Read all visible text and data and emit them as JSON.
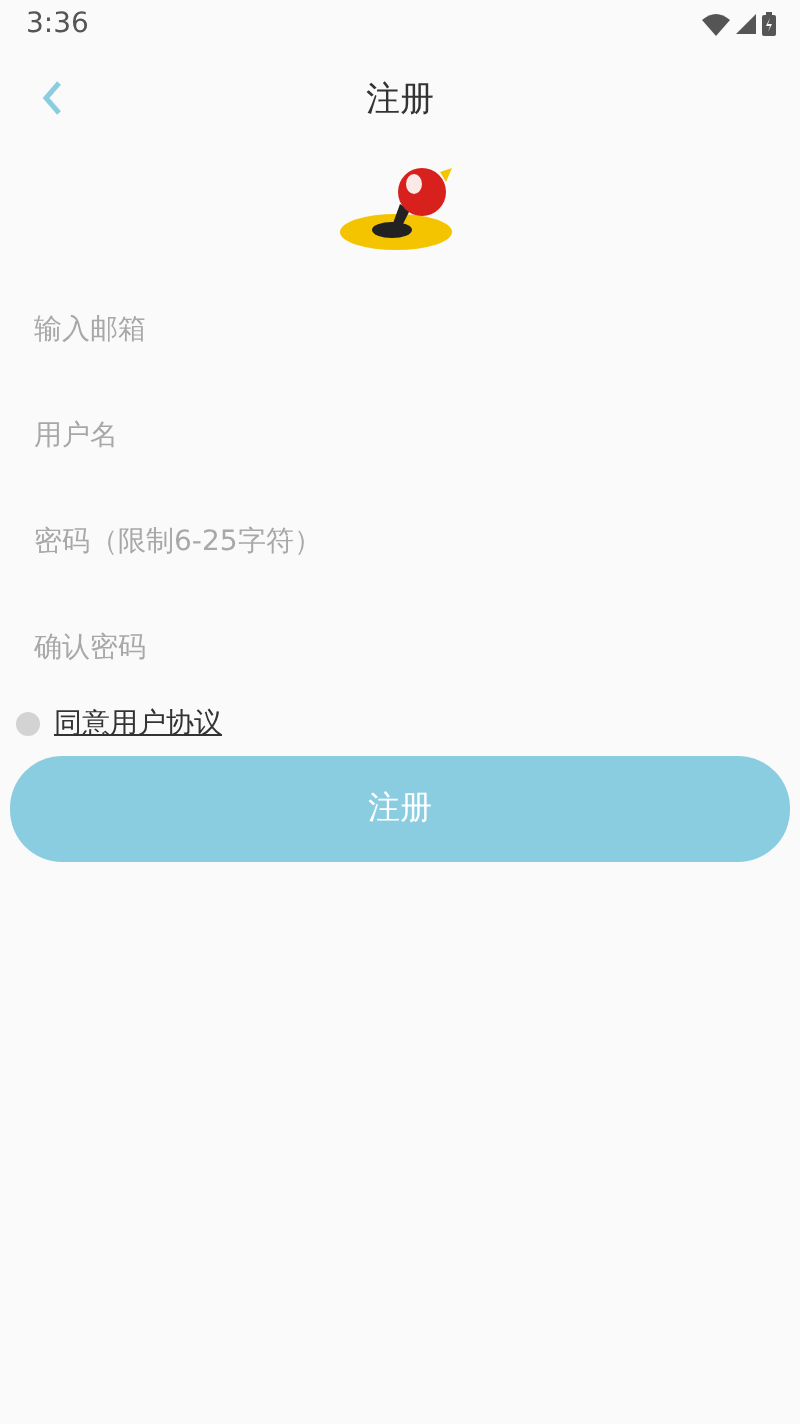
{
  "status_bar": {
    "time": "3:36"
  },
  "header": {
    "title": "注册"
  },
  "fields": [
    {
      "placeholder": "输入邮箱"
    },
    {
      "placeholder": "用户名"
    },
    {
      "placeholder": "密码（限制6-25字符）"
    },
    {
      "placeholder": "确认密码"
    }
  ],
  "agreement": {
    "label": "同意用户协议",
    "checked": false
  },
  "submit": {
    "label": "注册"
  }
}
